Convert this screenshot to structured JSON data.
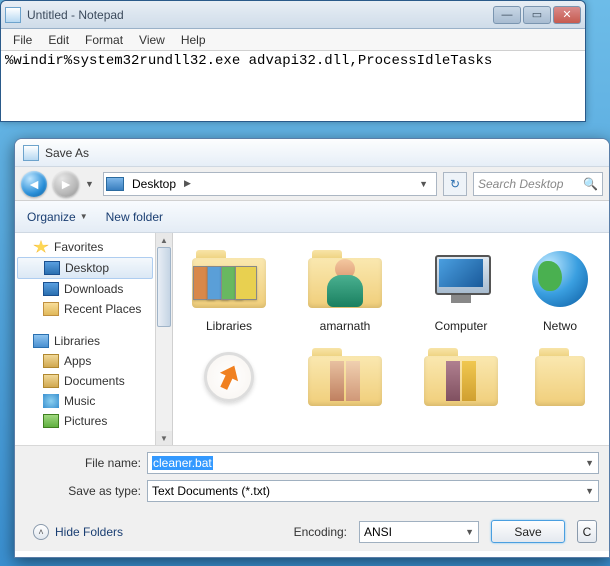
{
  "notepad": {
    "title": "Untitled - Notepad",
    "menu": {
      "file": "File",
      "edit": "Edit",
      "format": "Format",
      "view": "View",
      "help": "Help"
    },
    "content": "%windir%system32rundll32.exe advapi32.dll,ProcessIdleTasks",
    "winbtns": {
      "min": "—",
      "max": "▭",
      "close": "✕"
    }
  },
  "saveas": {
    "title": "Save As",
    "breadcrumb": {
      "location": "Desktop",
      "sep": "▶"
    },
    "search_placeholder": "Search Desktop",
    "toolbar": {
      "organize": "Organize",
      "newfolder": "New folder"
    },
    "tree": {
      "favorites": "Favorites",
      "items_fav": {
        "desktop": "Desktop",
        "downloads": "Downloads",
        "recent": "Recent Places"
      },
      "libraries": "Libraries",
      "items_lib": {
        "apps": "Apps",
        "documents": "Documents",
        "music": "Music",
        "pictures": "Pictures"
      }
    },
    "files": {
      "libraries": "Libraries",
      "amarnath": "amarnath",
      "computer": "Computer",
      "network": "Netwo"
    },
    "fields": {
      "filename_label": "File name:",
      "filename_value": "cleaner.bat",
      "type_label": "Save as type:",
      "type_value": "Text Documents (*.txt)"
    },
    "bottom": {
      "hide_folders": "Hide Folders",
      "encoding_label": "Encoding:",
      "encoding_value": "ANSI",
      "save": "Save",
      "cancel": "C"
    }
  }
}
